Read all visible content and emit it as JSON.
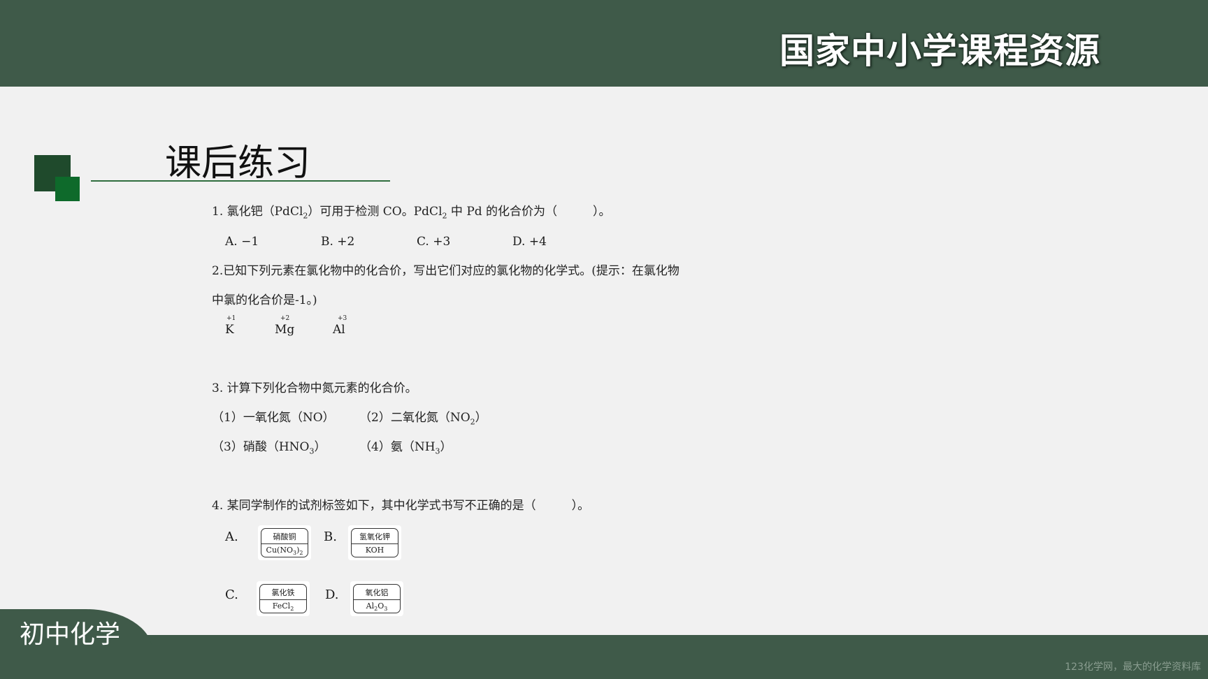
{
  "header": {
    "brand": "国家中小学课程资源"
  },
  "section": {
    "title": "课后练习"
  },
  "q1": {
    "pre": "1. 氯化钯（PdCl",
    "sub1": "2",
    "mid": "）可用于检测 CO。PdCl",
    "sub2": "2",
    "post": " 中 Pd 的化合价为（　　　）。",
    "options": [
      "A. −1",
      "B. +2",
      "C. +3",
      "D. +4"
    ]
  },
  "q2": {
    "line1": "2.已知下列元素在氯化物中的化合价，写出它们对应的氯化物的化学式。(提示：在氯化物",
    "line2": "中氯的化合价是-1。)",
    "elements": [
      {
        "symbol": "K",
        "valence": "+1"
      },
      {
        "symbol": "Mg",
        "valence": "+2"
      },
      {
        "symbol": "Al",
        "valence": "+3"
      }
    ]
  },
  "q3": {
    "title": "3. 计算下列化合物中氮元素的化合价。",
    "i1": "（1）一氧化氮（NO）",
    "i2_pre": "（2）二氧化氮（NO",
    "i2_sub": "2",
    "i2_post": "）",
    "i3_pre": "（3）硝酸（HNO",
    "i3_sub": "3",
    "i3_post": "）",
    "i4_pre": "（4）氨（NH",
    "i4_sub": "3",
    "i4_post": "）"
  },
  "q4": {
    "title": "4. 某同学制作的试剂标签如下，其中化学式书写不正确的是（　　　）。",
    "labels": [
      {
        "letter": "A.",
        "name": "硝酸铜",
        "f_pre": "Cu(NO",
        "f_sub": "3",
        "f_post": ")",
        "f_sub2": "2"
      },
      {
        "letter": "B.",
        "name": "氢氧化钾",
        "f_pre": "KOH",
        "f_sub": "",
        "f_post": "",
        "f_sub2": ""
      },
      {
        "letter": "C.",
        "name": "氯化铁",
        "f_pre": "FeCl",
        "f_sub": "2",
        "f_post": "",
        "f_sub2": ""
      },
      {
        "letter": "D.",
        "name": "氧化铝",
        "f_pre": "Al",
        "f_sub": "2",
        "f_post": "O",
        "f_sub2": "3"
      }
    ]
  },
  "footer": {
    "subject": "初中化学",
    "note": "123化学网，最大的化学资料库"
  },
  "colors": {
    "band": "#3f5a49",
    "accent_dark": "#1f4a2c",
    "accent_light": "#0e6a2b",
    "background": "#f1f1f1"
  }
}
